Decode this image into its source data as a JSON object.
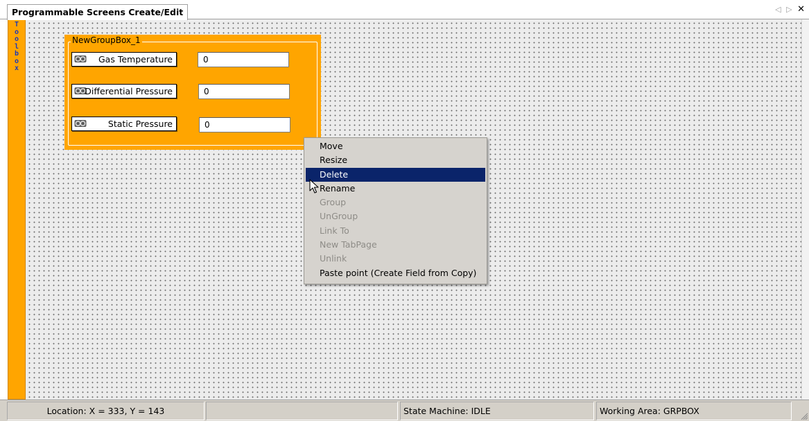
{
  "window": {
    "tab_title": "Programmable Screens Create/Edit",
    "tab_prev_glyph": "◁",
    "tab_next_glyph": "▷",
    "close_glyph": "✕"
  },
  "toolbox": {
    "letters": [
      "T",
      "o",
      "o",
      "l",
      "b",
      "o",
      "x"
    ]
  },
  "groupbox": {
    "title": "NewGroupBox_1",
    "fields": [
      {
        "label": "Gas Temperature",
        "value": "0",
        "icon": "chain-link-icon"
      },
      {
        "label": "Differential Pressure",
        "value": "0",
        "icon": "chain-link-icon"
      },
      {
        "label": "Static Pressure",
        "value": "0",
        "icon": "chain-link-icon"
      }
    ]
  },
  "context_menu": {
    "items": [
      {
        "label": "Move",
        "enabled": true,
        "selected": false
      },
      {
        "label": "Resize",
        "enabled": true,
        "selected": false
      },
      {
        "label": "Delete",
        "enabled": true,
        "selected": true
      },
      {
        "label": "Rename",
        "enabled": true,
        "selected": false
      },
      {
        "label": "Group",
        "enabled": false,
        "selected": false
      },
      {
        "label": "UnGroup",
        "enabled": false,
        "selected": false
      },
      {
        "label": "Link To",
        "enabled": false,
        "selected": false
      },
      {
        "label": "New TabPage",
        "enabled": false,
        "selected": false
      },
      {
        "label": "Unlink",
        "enabled": false,
        "selected": false
      },
      {
        "label": "Paste point (Create Field from Copy)",
        "enabled": true,
        "selected": false
      }
    ]
  },
  "statusbar": {
    "location": "Location: X = 333, Y = 143",
    "blank": "",
    "state_machine": "State Machine: IDLE",
    "working_area": "Working Area: GRPBOX"
  },
  "colors": {
    "toolbox_bg": "#ffa500",
    "groupbox_bg": "#ffa500",
    "menu_selected": "#0a246a",
    "toolbox_text": "#1f3ab5"
  }
}
